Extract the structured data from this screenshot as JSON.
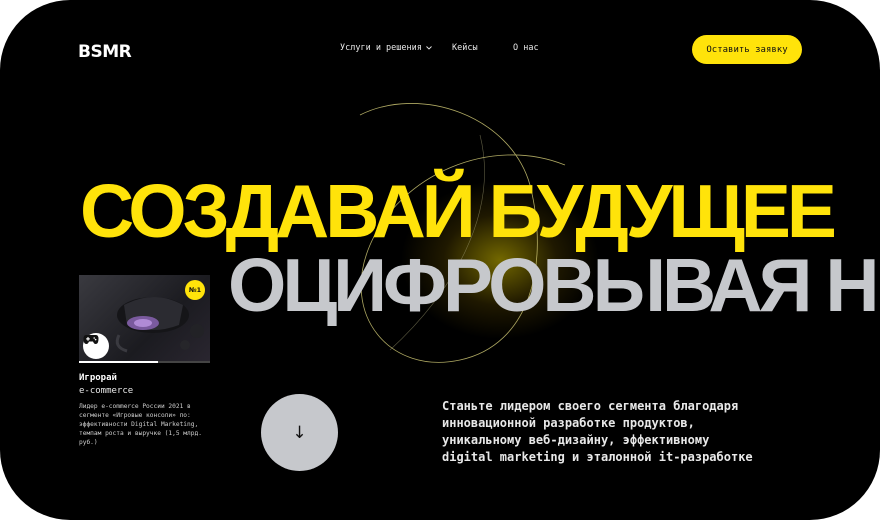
{
  "header": {
    "logo": "BSMR",
    "nav": [
      {
        "label": "Услуги и решения",
        "has_dropdown": true
      },
      {
        "label": "Кейсы"
      },
      {
        "label": "О нас"
      }
    ],
    "cta_label": "Оставить заявку"
  },
  "hero": {
    "line1": "СОЗДАВАЙ БУДУЩЕЕ",
    "line2": "ОЦИФРОВЫВАЯ Н",
    "tagline_lines": [
      "Станьте лидером своего сегмента благодаря",
      "инновационной разработке продуктов,",
      "уникальному веб-дизайну, эффективному",
      "digital marketing и эталонной it-разработке"
    ]
  },
  "case_card": {
    "badge": "№1",
    "title": "Игрорай",
    "tag": "e-commerce",
    "description": "Лидер e-commerce России 2021 в сегменте «Игровые консоли» по: эффективности Digital Marketing, темпам роста и выручке (1,5 млрд. руб.)",
    "progress": 0.6
  },
  "scroll_button": {
    "icon": "arrow-down-icon",
    "glyph": "↓"
  },
  "colors": {
    "background": "#000000",
    "accent": "#ffe30a",
    "secondary_text": "#c6c8cc"
  }
}
